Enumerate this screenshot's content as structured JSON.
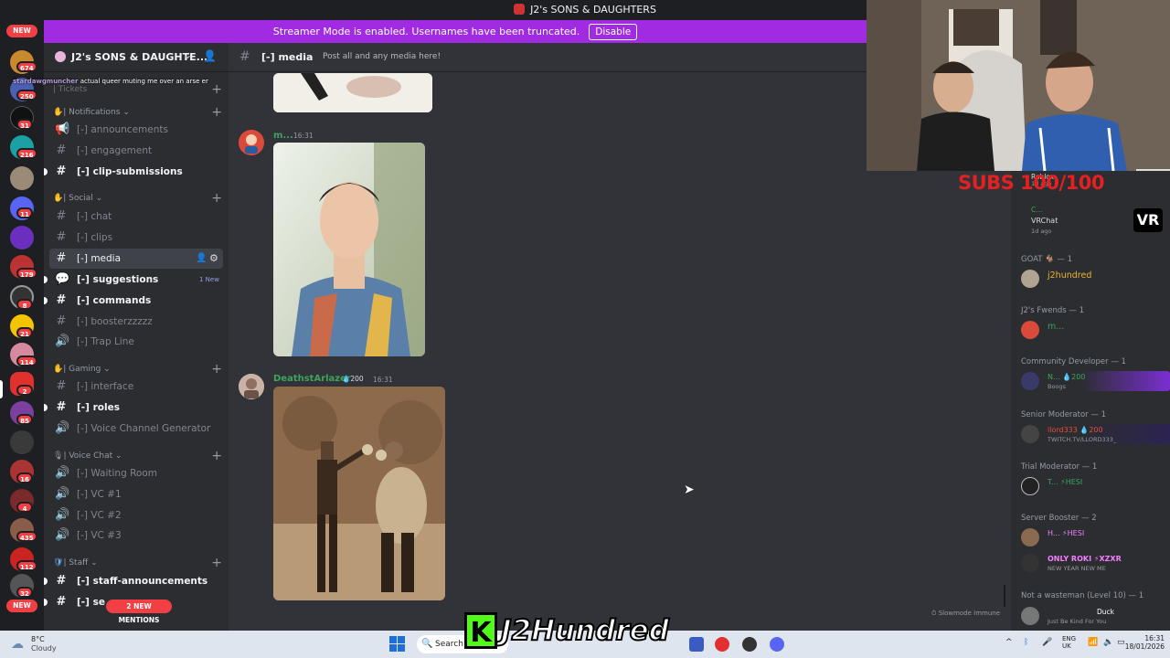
{
  "window": {
    "title": "J2's SONS & DAUGHTERS"
  },
  "banner": {
    "text": "Streamer Mode is enabled. Usernames have been truncated.",
    "button_label": "Disable"
  },
  "rail": {
    "new_top": "NEW",
    "new_bottom": "NEW",
    "badges": [
      "674",
      "250",
      "31",
      "216",
      "",
      "11",
      "",
      "179",
      "8",
      "21",
      "114",
      "2",
      "85",
      "",
      "16",
      "4",
      "435",
      "112",
      "32"
    ]
  },
  "server": {
    "name": "J2's SONS & DAUGHTE...",
    "stream_chat": "stardawgmuncher",
    "stream_chat_msg": "actual queer muting me over an arse er"
  },
  "sidebar": {
    "categories": {
      "tickets": "| Tickets",
      "notifications": "| Notifications",
      "social": "| Social",
      "gaming": "| Gaming",
      "voice": "| Voice Chat",
      "staff": "| Staff"
    },
    "channels": {
      "announcements": "[-]  announcements",
      "engagement": "[-]  engagement",
      "clip_submissions": "[-]  clip-submissions",
      "chat": "[-]  chat",
      "clips": "[-]  clips",
      "media": "[-]  media",
      "suggestions": "[-]  suggestions",
      "suggestions_badge": "1 New",
      "commands": "[-]  commands",
      "boosterzzzzz": "[-]  boosterzzzzz",
      "trap_line": "[-]  Trap Line",
      "interface": "[-]  interface",
      "roles": "[-]  roles",
      "voice_gen": "[-]  Voice Channel Generator ...",
      "waiting_room": "[-]  Waiting Room",
      "vc1": "[-]  VC #1",
      "vc2": "[-]  VC #2",
      "vc3": "[-]  VC #3",
      "staff_announcements": "[-]  staff-announcements",
      "staff_other": "[-]  se"
    },
    "mentions": "2 NEW MENTIONS"
  },
  "channel": {
    "name": "[-]  media",
    "topic": "Post all and any media here!"
  },
  "messages": [
    {
      "author": "m...",
      "time": "16:31"
    },
    {
      "author": "DeathstArlazer",
      "boost": "200",
      "time": "16:31"
    }
  ],
  "footer": {
    "slowmode": "Slowmode Immune"
  },
  "members": {
    "top": [
      {
        "name": "Roblox",
        "sub": "1d ago"
      },
      {
        "name": "C...",
        "sub": ""
      },
      {
        "name": "VRChat",
        "sub": "1d ago"
      }
    ],
    "roles": [
      {
        "role": "GOAT 🐐 — 1",
        "members": [
          {
            "name": "j2hundred",
            "color": "#f0b232",
            "sub": ""
          }
        ]
      },
      {
        "role": "J2's Fwends — 1",
        "members": [
          {
            "name": "m...",
            "color": "#3ba55c",
            "sub": ""
          }
        ]
      },
      {
        "role": "Community Developer — 1",
        "members": [
          {
            "name": "N... 💧200",
            "color": "#3ba55c",
            "sub": "Boogs"
          }
        ]
      },
      {
        "role": "Senior Moderator — 1",
        "members": [
          {
            "name": "llord333 💧200",
            "color": "#e74c3c",
            "sub": "TWITCH.TV/LLORD333_"
          }
        ]
      },
      {
        "role": "Trial Moderator — 1",
        "members": [
          {
            "name": "T... ⚡HESI",
            "color": "#3ba55c",
            "sub": ""
          }
        ]
      },
      {
        "role": "Server Booster — 2",
        "members": [
          {
            "name": "H... ⚡HESI",
            "color": "#f47fff",
            "sub": ""
          },
          {
            "name": "ONLY ROKI ⚡XZXR",
            "color": "#f47fff",
            "sub": "NEW YEAR NEW ME"
          }
        ]
      },
      {
        "role": "Not a wasteman (Level 10) — 1",
        "members": [
          {
            "name": "Duck",
            "color": "#3ba55c",
            "sub": "Just Be Kind For You"
          }
        ]
      }
    ]
  },
  "overlay": {
    "subs": "SUBS 100/100",
    "logo": "J2Hundred",
    "vr": "VR"
  },
  "taskbar": {
    "weather_temp": "8°C",
    "weather_desc": "Cloudy",
    "search": "Search",
    "lang": "ENG",
    "region": "UK",
    "time": "16:31",
    "date": "18/01/2026"
  }
}
